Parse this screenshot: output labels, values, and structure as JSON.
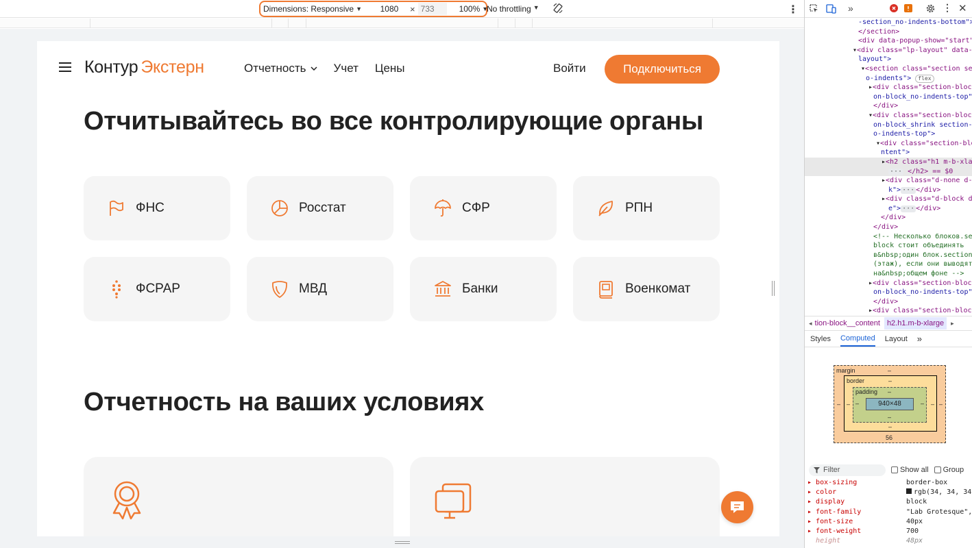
{
  "device_toolbar": {
    "dimensions_label": "Dimensions: Responsive",
    "width_value": "1080",
    "height_placeholder": "733",
    "times": "×",
    "zoom": "100%",
    "throttling": "No throttling"
  },
  "header": {
    "logo_part1": "Контур",
    "logo_part2": "Экстерн",
    "nav": [
      {
        "label": "Отчетность"
      },
      {
        "label": "Учет"
      },
      {
        "label": "Цены"
      }
    ],
    "login": "Войти",
    "connect": "Подключиться"
  },
  "section1": {
    "title": "Отчитывайтесь во все контролирующие органы",
    "cards": [
      {
        "label": "ФНС",
        "icon": "flag-icon"
      },
      {
        "label": "Росстат",
        "icon": "pie-chart-icon"
      },
      {
        "label": "СФР",
        "icon": "umbrella-icon"
      },
      {
        "label": "РПН",
        "icon": "leaf-icon"
      },
      {
        "label": "ФСРАР",
        "icon": "grapes-icon"
      },
      {
        "label": "МВД",
        "icon": "shield-icon"
      },
      {
        "label": "Банки",
        "icon": "bank-icon"
      },
      {
        "label": "Военкомат",
        "icon": "book-icon"
      }
    ]
  },
  "section2": {
    "title": "Отчетность на ваших условиях"
  },
  "colors": {
    "accent": "#ef7a32",
    "text": "#222222",
    "card_bg": "#f5f5f5"
  },
  "devtools": {
    "code_lines": [
      "-section_no-indents-bottom\">",
      "</section>",
      "<div data-popup-show=\"start\">",
      "<div class=\"lp-layout\" data-",
      "layout\">",
      "<section class=\"section sec",
      "o-indents\">",
      "<div class=\"section-block",
      "on-block_no-indents-top\">",
      "</div>",
      "<div class=\"section-block",
      "on-block_shrink section-b",
      "o-indents-top\">",
      "<div class=\"section-blo",
      "ntent\">",
      "<h2 class=\"h1 m-b-xla",
      "</h2> == $0",
      "<div class=\"d-none d-",
      "k\">",
      "</div>",
      "<div class=\"d-block d",
      "e\">",
      "</div>",
      "</div>",
      "</div>",
      "<!-- Несколько блоков.sec",
      "block стоит объединять",
      "в&nbsp;один блок.section",
      "(этаж), если они выводят",
      "на&nbsp;общем фоне -->",
      "<div class=\"section-block",
      "on-block_no-indents-top\">",
      "</div>",
      "<div class=\"section-block"
    ],
    "flex_badge": "flex",
    "breadcrumb_1": "tion-block__content",
    "breadcrumb_2": "h2.h1.m-b-xlarge",
    "tabs": [
      "Styles",
      "Computed",
      "Layout"
    ],
    "box_model": {
      "margin": "margin",
      "border": "border",
      "padding": "padding",
      "content": "940×48",
      "dash": "–",
      "margin_bottom": "56"
    },
    "filter_label": "Filter",
    "show_all": "Show all",
    "group": "Group",
    "properties": [
      {
        "name": "box-sizing",
        "value": "border-box"
      },
      {
        "name": "color",
        "value": "rgb(34, 34, 34"
      },
      {
        "name": "display",
        "value": "block"
      },
      {
        "name": "font-family",
        "value": "\"Lab Grotesque\","
      },
      {
        "name": "font-size",
        "value": "40px"
      },
      {
        "name": "font-weight",
        "value": "700"
      },
      {
        "name": "height",
        "value": "48px"
      }
    ]
  }
}
